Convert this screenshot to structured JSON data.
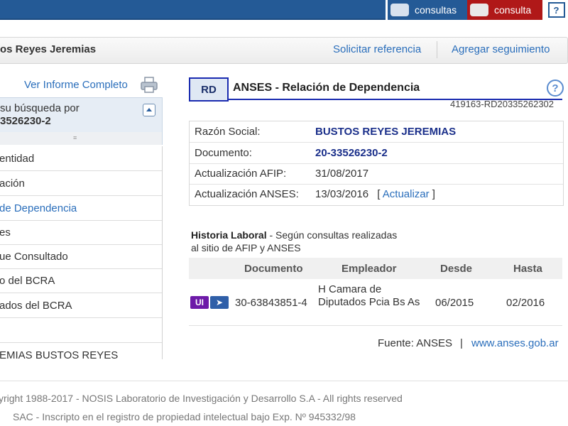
{
  "topbar": {
    "consultas_label": "consultas",
    "consulta_label": "consulta",
    "help_label": "?"
  },
  "header": {
    "name": "os Reyes Jeremias",
    "solicitar": "Solicitar referencia",
    "agregar": "Agregar seguimiento"
  },
  "sidebar": {
    "ver_informe": "Ver Informe Completo",
    "search_line1": "su búsqueda por",
    "search_line2": "3526230-2",
    "drag_handle": "≡",
    "items": [
      {
        "label": "entidad"
      },
      {
        "label": "ación"
      },
      {
        "label": "de Dependencia"
      },
      {
        "label": "es"
      },
      {
        "label": "ue Consultado"
      },
      {
        "label": "o del BCRA"
      },
      {
        "label": "ados del BCRA"
      },
      {
        "label": ""
      },
      {
        "label": "EMIAS BUSTOS REYES"
      }
    ]
  },
  "main": {
    "badge": "RD",
    "title": "ANSES - Relación de Dependencia",
    "help": "?",
    "ref_code": "419163-RD20335262302",
    "info": {
      "razon_label": "Razón Social:",
      "razon_value": "BUSTOS REYES JEREMIAS",
      "doc_label": "Documento:",
      "doc_value": "20-33526230-2",
      "afip_label": "Actualización AFIP:",
      "afip_value": "31/08/2017",
      "anses_label": "Actualización ANSES:",
      "anses_value": "13/03/2016",
      "bracket_open": "[",
      "actualizar": "Actualizar",
      "bracket_close": "]"
    },
    "historia": {
      "title": "Historia Laboral",
      "subtitle": " - Según consultas realizadas",
      "subtitle2": "al sitio de AFIP y ANSES",
      "headers": [
        "Documento",
        "Empleador",
        "Desde",
        "Hasta"
      ],
      "row": {
        "ui_badge": "UI",
        "cursor_badge": "➤",
        "documento": "30-63843851-4",
        "empleador": "H Camara de Diputados Pcia Bs As",
        "desde": "06/2015",
        "hasta": "02/2016"
      }
    },
    "fuente": "Fuente: ANSES",
    "fuente_sep": "|",
    "fuente_link": "www.anses.gob.ar"
  },
  "footer": {
    "line1": "yright 1988-2017 - NOSIS Laboratorio de Investigación y Desarrollo S.A - All rights reserved",
    "line2": "SAC - Inscripto en el registro de propiedad intelectual bajo Exp. Nº 945332/98"
  },
  "colors": {
    "topbar_blue": "#245a96",
    "consulta_red": "#b01818",
    "link_blue": "#2a6ebb",
    "badge_border": "#1a2bb0",
    "ui_purple": "#6d1aa8"
  }
}
